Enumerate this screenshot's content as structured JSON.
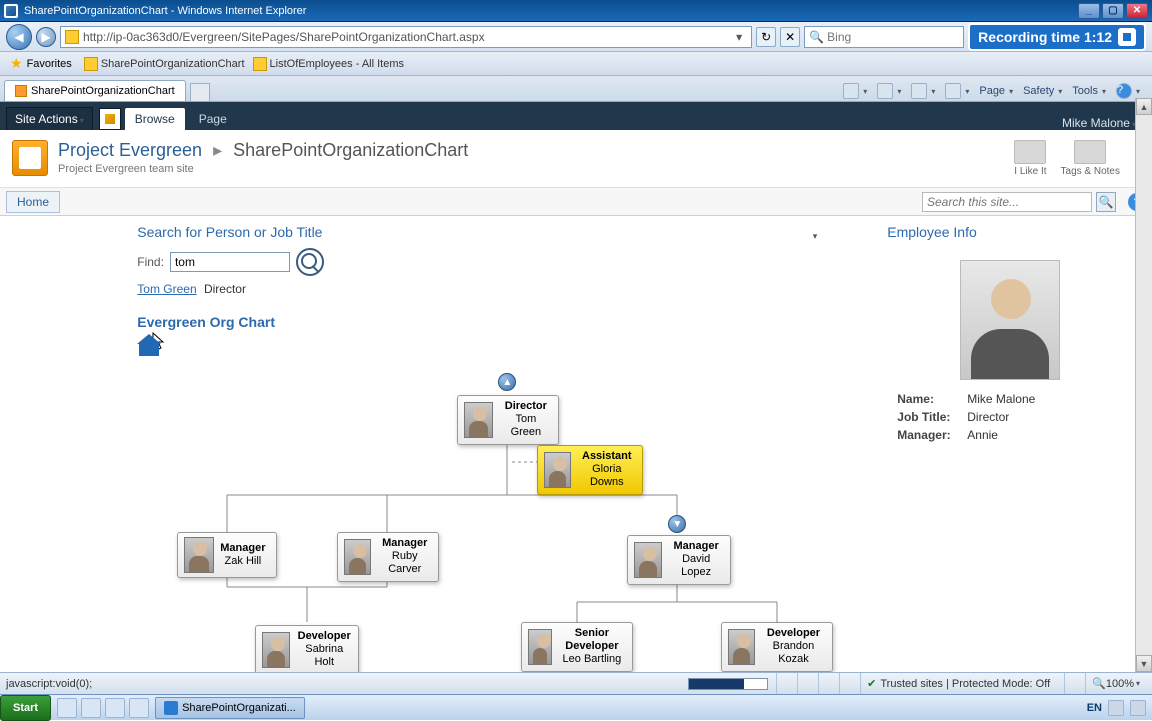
{
  "ie": {
    "title": "SharePointOrganizationChart - Windows Internet Explorer",
    "url": "http://ip-0ac363d0/Evergreen/SitePages/SharePointOrganizationChart.aspx",
    "search_placeholder": "Bing",
    "recording": "Recording time 1:12",
    "favorites_label": "Favorites",
    "fav_links": [
      {
        "label": "SharePointOrganizationChart"
      },
      {
        "label": "ListOfEmployees - All Items"
      }
    ],
    "tab_label": "SharePointOrganizationChart",
    "cmd": {
      "page": "Page",
      "safety": "Safety",
      "tools": "Tools"
    },
    "status_left": "javascript:void(0);",
    "status_security": "Trusted sites | Protected Mode: Off",
    "zoom": "100%"
  },
  "sp": {
    "site_actions": "Site Actions",
    "tabs": {
      "browse": "Browse",
      "page": "Page"
    },
    "user": "Mike Malone",
    "bc_project": "Project Evergreen",
    "bc_page": "SharePointOrganizationChart",
    "bc_sub": "Project Evergreen team site",
    "home": "Home",
    "search_placeholder": "Search this site...",
    "social": {
      "like": "I Like It",
      "tags": "Tags & Notes"
    }
  },
  "search": {
    "heading": "Search for Person or Job Title",
    "find_label": "Find:",
    "find_value": "tom",
    "result_name": "Tom Green",
    "result_title": "Director"
  },
  "org": {
    "heading": "Evergreen Org Chart",
    "nodes": {
      "director": {
        "title": "Director",
        "name": "Tom Green"
      },
      "assistant": {
        "title": "Assistant",
        "name": "Gloria Downs"
      },
      "mgr1": {
        "title": "Manager",
        "name": "Zak Hill"
      },
      "mgr2": {
        "title": "Manager",
        "name": "Ruby Carver"
      },
      "mgr3": {
        "title": "Manager",
        "name": "David Lopez"
      },
      "dev1": {
        "title": "Developer",
        "name": "Sabrina Holt"
      },
      "dev2": {
        "title": "Senior Developer",
        "name": "Leo Bartling"
      },
      "dev3": {
        "title": "Developer",
        "name": "Brandon Kozak"
      }
    }
  },
  "employee": {
    "heading": "Employee Info",
    "labels": {
      "name": "Name:",
      "job": "Job Title:",
      "manager": "Manager:"
    },
    "values": {
      "name": "Mike Malone",
      "job": "Director",
      "manager": "Annie"
    }
  },
  "taskbar": {
    "start": "Start",
    "running": "SharePointOrganizati...",
    "lang": "EN"
  }
}
